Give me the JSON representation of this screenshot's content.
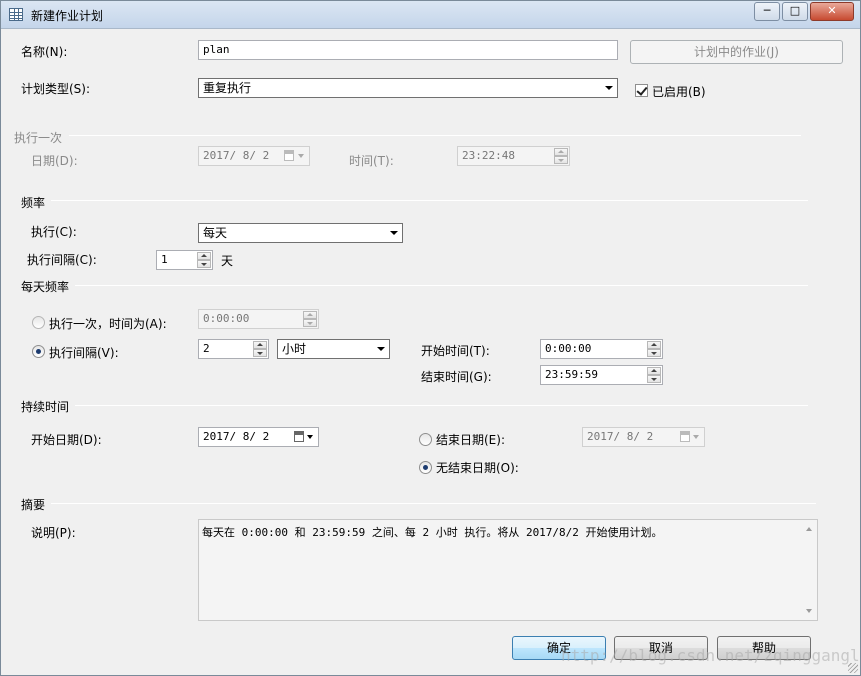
{
  "window": {
    "title": "新建作业计划",
    "controls": {
      "minimize": "─",
      "maximize": "□",
      "close": "✕"
    }
  },
  "name": {
    "label": "名称(N):",
    "value": "plan",
    "jobs_button": "计划中的作业(J)"
  },
  "schedule_type": {
    "label": "计划类型(S):",
    "value": "重复执行",
    "enabled_label": "已启用(B)",
    "enabled": true
  },
  "one_time": {
    "group_label": "执行一次",
    "date_label": "日期(D):",
    "date_value": "2017/ 8/ 2",
    "time_label": "时间(T):",
    "time_value": "23:22:48"
  },
  "frequency": {
    "group_label": "频率",
    "occurs_label": "执行(C):",
    "occurs_value": "每天",
    "recurs_label": "执行间隔(C):",
    "recurs_value": "1",
    "recurs_unit": "天"
  },
  "daily_frequency": {
    "group_label": "每天频率",
    "once_label": "执行一次，时间为(A):",
    "once_value": "0:00:00",
    "once_selected": false,
    "every_label": "执行间隔(V):",
    "every_value": "2",
    "every_unit": "小时",
    "every_selected": true,
    "start_label": "开始时间(T):",
    "start_value": "0:00:00",
    "end_label": "结束时间(G):",
    "end_value": "23:59:59"
  },
  "duration": {
    "group_label": "持续时间",
    "start_date_label": "开始日期(D):",
    "start_date_value": "2017/ 8/ 2",
    "end_date_label": "结束日期(E):",
    "end_date_value": "2017/ 8/ 2",
    "end_date_selected": false,
    "no_end_label": "无结束日期(O):",
    "no_end_selected": true
  },
  "summary": {
    "group_label": "摘要",
    "desc_label": "说明(P):",
    "desc_value": "每天在 0:00:00 和 23:59:59 之间、每 2 小时 执行。将从 2017/8/2 开始使用计划。"
  },
  "buttons": {
    "ok": "确定",
    "cancel": "取消",
    "help": "帮助"
  },
  "watermark": "http://blog.csdn.net/zqinggangl"
}
